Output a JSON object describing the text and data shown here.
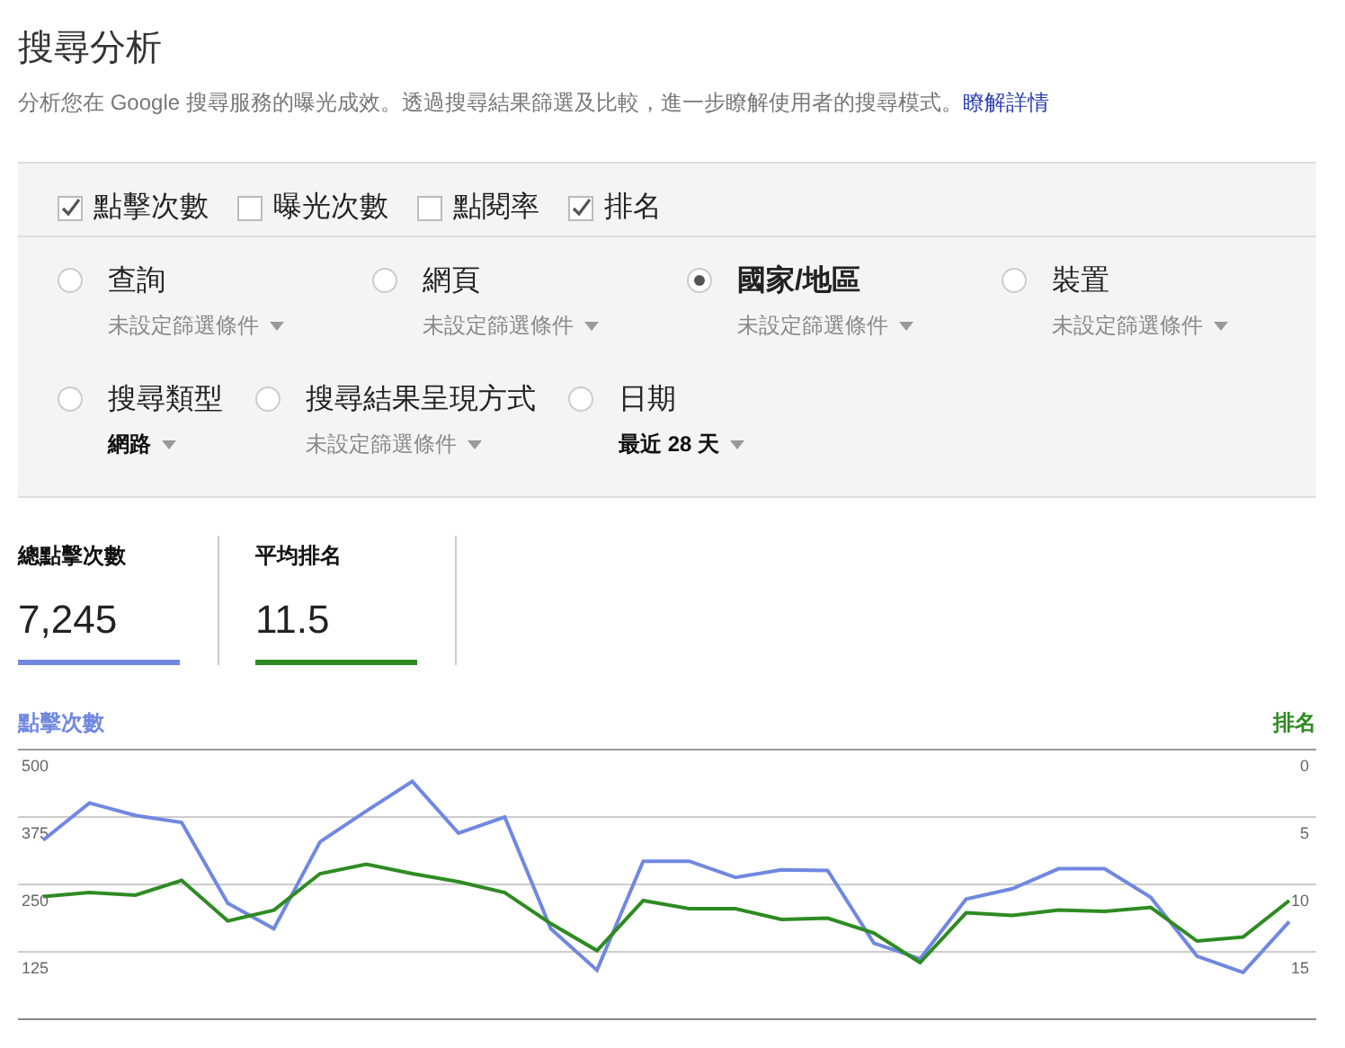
{
  "page": {
    "title": "搜尋分析",
    "description": "分析您在 Google 搜尋服務的曝光成效。透過搜尋結果篩選及比較，進一步瞭解使用者的搜尋模式。",
    "link": "瞭解詳情"
  },
  "metric_toggles": [
    {
      "label": "點擊次數",
      "checked": true
    },
    {
      "label": "曝光次數",
      "checked": false
    },
    {
      "label": "點閱率",
      "checked": false
    },
    {
      "label": "排名",
      "checked": true
    }
  ],
  "grouping_rows": [
    {
      "options": [
        {
          "label": "查詢",
          "selected": false,
          "filter": "未設定篩選條件",
          "filter_set": false
        },
        {
          "label": "網頁",
          "selected": false,
          "filter": "未設定篩選條件",
          "filter_set": false
        },
        {
          "label": "國家/地區",
          "selected": true,
          "filter": "未設定篩選條件",
          "filter_set": false
        },
        {
          "label": "裝置",
          "selected": false,
          "filter": "未設定篩選條件",
          "filter_set": false
        }
      ]
    },
    {
      "options": [
        {
          "label": "搜尋類型",
          "selected": false,
          "filter": "網路",
          "filter_set": true
        },
        {
          "label": "搜尋結果呈現方式",
          "selected": false,
          "filter": "未設定篩選條件",
          "filter_set": false
        },
        {
          "label": "日期",
          "selected": false,
          "filter": "最近 28 天",
          "filter_set": true
        }
      ]
    }
  ],
  "metric_cards": [
    {
      "label": "總點擊次數",
      "value": "7,245",
      "color": "#7088e0"
    },
    {
      "label": "平均排名",
      "value": "11.5",
      "color": "#2e8b22"
    }
  ],
  "chart": {
    "chart_data": {
      "type": "line",
      "grid": true,
      "ylim": [
        0,
        500
      ],
      "y2lim": [
        20,
        0
      ],
      "yticks": [
        125,
        250,
        375,
        500
      ],
      "y2ticks": [
        0,
        5,
        10,
        15
      ],
      "series": [
        {
          "name": "點擊次數",
          "color": "#7088e0",
          "values": [
            332,
            401,
            378,
            365,
            215,
            168,
            329,
            386,
            441,
            345,
            375,
            168,
            91,
            293,
            293,
            263,
            277,
            276,
            141,
            112,
            223,
            242,
            279,
            279,
            226,
            117,
            87,
            181
          ]
        },
        {
          "name": "排名",
          "color": "#2e8b22",
          "axis": "y2",
          "values": [
            10.9,
            10.6,
            10.8,
            9.7,
            12.7,
            11.9,
            9.2,
            8.5,
            9.2,
            9.8,
            10.6,
            12.9,
            14.9,
            11.2,
            11.8,
            11.8,
            12.6,
            12.5,
            13.6,
            15.8,
            12.1,
            12.3,
            11.9,
            12.0,
            11.7,
            14.2,
            13.9,
            11.2
          ]
        }
      ]
    }
  }
}
